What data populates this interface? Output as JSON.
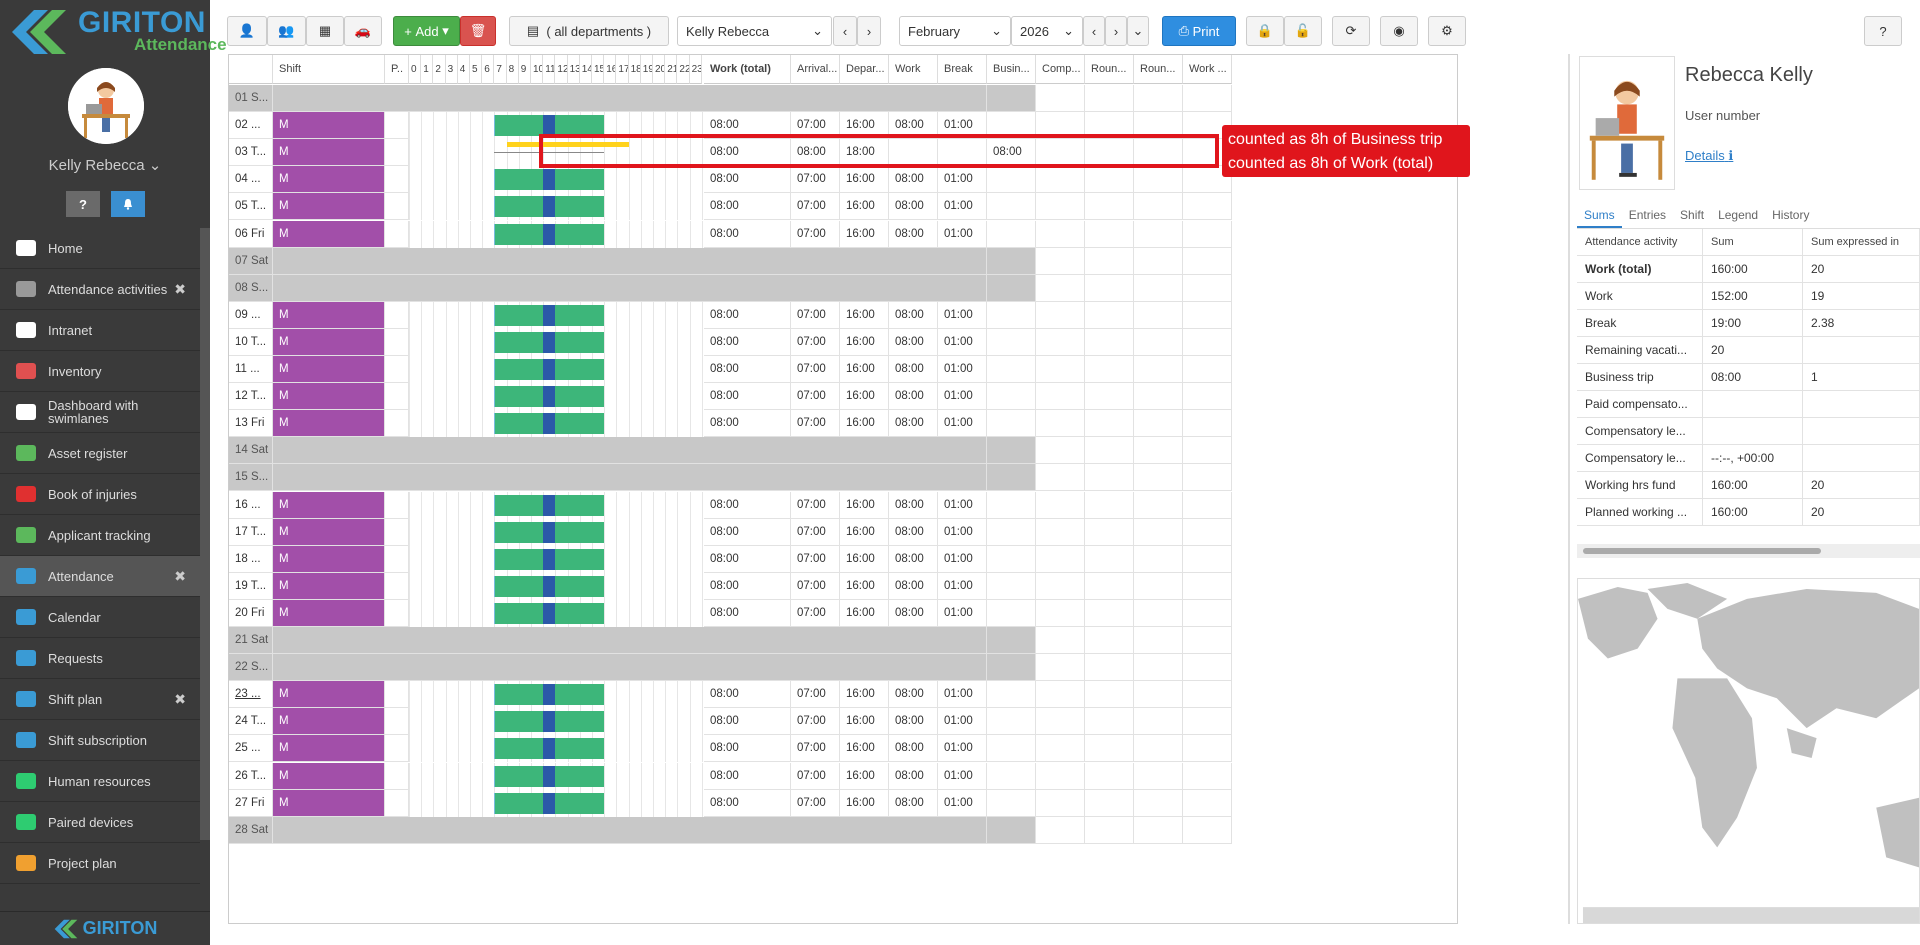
{
  "brand": {
    "name": "GIRITON",
    "subtitle": "Attendance",
    "footer": "GIRITON"
  },
  "user": {
    "name": "Kelly Rebecca"
  },
  "sidebar_icons": {
    "help": "?",
    "notify": "bell-icon"
  },
  "nav": [
    {
      "label": "Home",
      "icon": "home-icon",
      "closable": false,
      "active": false,
      "color": "#ffffff"
    },
    {
      "label": "Attendance activities",
      "icon": "gears-icon",
      "closable": true,
      "active": false,
      "color": "#999999"
    },
    {
      "label": "Intranet",
      "icon": "bank-icon",
      "closable": false,
      "active": false,
      "color": "#ffffff"
    },
    {
      "label": "Inventory",
      "icon": "circle-icon",
      "closable": false,
      "active": false,
      "color": "#e05050"
    },
    {
      "label": "Dashboard with swimlanes",
      "icon": "columns-icon",
      "closable": false,
      "active": false,
      "color": "#ffffff"
    },
    {
      "label": "Asset register",
      "icon": "archive-icon",
      "closable": false,
      "active": false,
      "color": "#5cb85c"
    },
    {
      "label": "Book of injuries",
      "icon": "ambulance-icon",
      "closable": false,
      "active": false,
      "color": "#e03030"
    },
    {
      "label": "Applicant tracking",
      "icon": "user-plus-icon",
      "closable": false,
      "active": false,
      "color": "#5cb85c"
    },
    {
      "label": "Attendance",
      "icon": "user-icon",
      "closable": true,
      "active": true,
      "color": "#3a9bd5"
    },
    {
      "label": "Calendar",
      "icon": "calendar-icon",
      "closable": false,
      "active": false,
      "color": "#3a9bd5"
    },
    {
      "label": "Requests",
      "icon": "gavel-icon",
      "closable": false,
      "active": false,
      "color": "#3a9bd5"
    },
    {
      "label": "Shift plan",
      "icon": "calendar-grid-icon",
      "closable": true,
      "active": false,
      "color": "#3a9bd5"
    },
    {
      "label": "Shift subscription",
      "icon": "calendar-check-icon",
      "closable": false,
      "active": false,
      "color": "#3a9bd5"
    },
    {
      "label": "Human resources",
      "icon": "person-icon",
      "closable": false,
      "active": false,
      "color": "#2ecc71"
    },
    {
      "label": "Paired devices",
      "icon": "mobile-icon",
      "closable": false,
      "active": false,
      "color": "#2ecc71"
    },
    {
      "label": "Project plan",
      "icon": "calendar-orange-icon",
      "closable": false,
      "active": false,
      "color": "#f0a030"
    }
  ],
  "toolbar": {
    "add_label": "Add",
    "department": "( all departments )",
    "employee": "Kelly Rebecca",
    "month": "February",
    "year": "2026",
    "print_label": "Print"
  },
  "columns": {
    "shift": "Shift",
    "p": "P..",
    "hours": [
      "0",
      "1",
      "2",
      "3",
      "4",
      "5",
      "6",
      "7",
      "8",
      "9",
      "10",
      "11",
      "12",
      "13",
      "14",
      "15",
      "16",
      "17",
      "18",
      "19",
      "20",
      "21",
      "22",
      "23"
    ],
    "work_total": "Work (total)",
    "arrival": "Arrival...",
    "departure": "Depar...",
    "work": "Work",
    "break": "Break",
    "business": "Busin...",
    "comp": "Comp...",
    "round1": "Roun...",
    "round2": "Roun...",
    "work2": "Work ..."
  },
  "rows": [
    {
      "day": "01 S...",
      "weekend": true
    },
    {
      "day": "02 ...",
      "shift": "M",
      "work_total": "08:00",
      "arrival": "07:00",
      "departure": "16:00",
      "work": "08:00",
      "break": "01:00"
    },
    {
      "day": "03 T...",
      "shift": "M",
      "work_total": "08:00",
      "arrival": "08:00",
      "departure": "18:00",
      "work": "",
      "break": "",
      "business": "08:00",
      "trip": true
    },
    {
      "day": "04 ...",
      "shift": "M",
      "work_total": "08:00",
      "arrival": "07:00",
      "departure": "16:00",
      "work": "08:00",
      "break": "01:00"
    },
    {
      "day": "05 T...",
      "shift": "M",
      "work_total": "08:00",
      "arrival": "07:00",
      "departure": "16:00",
      "work": "08:00",
      "break": "01:00"
    },
    {
      "day": "06 Fri",
      "shift": "M",
      "work_total": "08:00",
      "arrival": "07:00",
      "departure": "16:00",
      "work": "08:00",
      "break": "01:00"
    },
    {
      "day": "07 Sat",
      "weekend": true
    },
    {
      "day": "08 S...",
      "weekend": true
    },
    {
      "day": "09 ...",
      "shift": "M",
      "work_total": "08:00",
      "arrival": "07:00",
      "departure": "16:00",
      "work": "08:00",
      "break": "01:00"
    },
    {
      "day": "10 T...",
      "shift": "M",
      "work_total": "08:00",
      "arrival": "07:00",
      "departure": "16:00",
      "work": "08:00",
      "break": "01:00"
    },
    {
      "day": "11 ...",
      "shift": "M",
      "work_total": "08:00",
      "arrival": "07:00",
      "departure": "16:00",
      "work": "08:00",
      "break": "01:00"
    },
    {
      "day": "12 T...",
      "shift": "M",
      "work_total": "08:00",
      "arrival": "07:00",
      "departure": "16:00",
      "work": "08:00",
      "break": "01:00"
    },
    {
      "day": "13 Fri",
      "shift": "M",
      "work_total": "08:00",
      "arrival": "07:00",
      "departure": "16:00",
      "work": "08:00",
      "break": "01:00"
    },
    {
      "day": "14 Sat",
      "weekend": true
    },
    {
      "day": "15 S...",
      "weekend": true
    },
    {
      "day": "16 ...",
      "shift": "M",
      "work_total": "08:00",
      "arrival": "07:00",
      "departure": "16:00",
      "work": "08:00",
      "break": "01:00"
    },
    {
      "day": "17 T...",
      "shift": "M",
      "work_total": "08:00",
      "arrival": "07:00",
      "departure": "16:00",
      "work": "08:00",
      "break": "01:00"
    },
    {
      "day": "18 ...",
      "shift": "M",
      "work_total": "08:00",
      "arrival": "07:00",
      "departure": "16:00",
      "work": "08:00",
      "break": "01:00"
    },
    {
      "day": "19 T...",
      "shift": "M",
      "work_total": "08:00",
      "arrival": "07:00",
      "departure": "16:00",
      "work": "08:00",
      "break": "01:00"
    },
    {
      "day": "20 Fri",
      "shift": "M",
      "work_total": "08:00",
      "arrival": "07:00",
      "departure": "16:00",
      "work": "08:00",
      "break": "01:00"
    },
    {
      "day": "21 Sat",
      "weekend": true
    },
    {
      "day": "22 S...",
      "weekend": true
    },
    {
      "day": "23 ...",
      "shift": "M",
      "work_total": "08:00",
      "arrival": "07:00",
      "departure": "16:00",
      "work": "08:00",
      "break": "01:00",
      "today": true
    },
    {
      "day": "24 T...",
      "shift": "M",
      "work_total": "08:00",
      "arrival": "07:00",
      "departure": "16:00",
      "work": "08:00",
      "break": "01:00"
    },
    {
      "day": "25 ...",
      "shift": "M",
      "work_total": "08:00",
      "arrival": "07:00",
      "departure": "16:00",
      "work": "08:00",
      "break": "01:00"
    },
    {
      "day": "26 T...",
      "shift": "M",
      "work_total": "08:00",
      "arrival": "07:00",
      "departure": "16:00",
      "work": "08:00",
      "break": "01:00"
    },
    {
      "day": "27 Fri",
      "shift": "M",
      "work_total": "08:00",
      "arrival": "07:00",
      "departure": "16:00",
      "work": "08:00",
      "break": "01:00"
    },
    {
      "day": "28 Sat",
      "weekend": true
    }
  ],
  "callout": {
    "line1": "counted as 8h of Business trip",
    "line2": "counted as 8h of Work (total)"
  },
  "profile": {
    "name": "Rebecca Kelly",
    "user_number_label": "User number",
    "details_label": "Details"
  },
  "tabs": [
    "Sums",
    "Entries",
    "Shift",
    "Legend",
    "History"
  ],
  "sums_table": {
    "headers": [
      "Attendance activity",
      "Sum",
      "Sum expressed in"
    ],
    "rows": [
      [
        "Work (total)",
        "160:00",
        "20"
      ],
      [
        "Work",
        "152:00",
        "19"
      ],
      [
        "Break",
        "19:00",
        "2.38"
      ],
      [
        "Remaining vacati...",
        "20",
        ""
      ],
      [
        "Business trip",
        "08:00",
        "1"
      ],
      [
        "Paid compensato...",
        "",
        ""
      ],
      [
        "Compensatory le...",
        "",
        ""
      ],
      [
        "Compensatory le...",
        "--:--, +00:00",
        ""
      ],
      [
        "Working hrs fund",
        "160:00",
        "20"
      ],
      [
        "Planned working ...",
        "160:00",
        "20"
      ]
    ]
  },
  "colors": {
    "shift_m": "#a24fa9",
    "gantt": "#3db67a",
    "break": "#2b59a8",
    "highlight": "#e0151c",
    "weekend": "#c8c8c8"
  }
}
